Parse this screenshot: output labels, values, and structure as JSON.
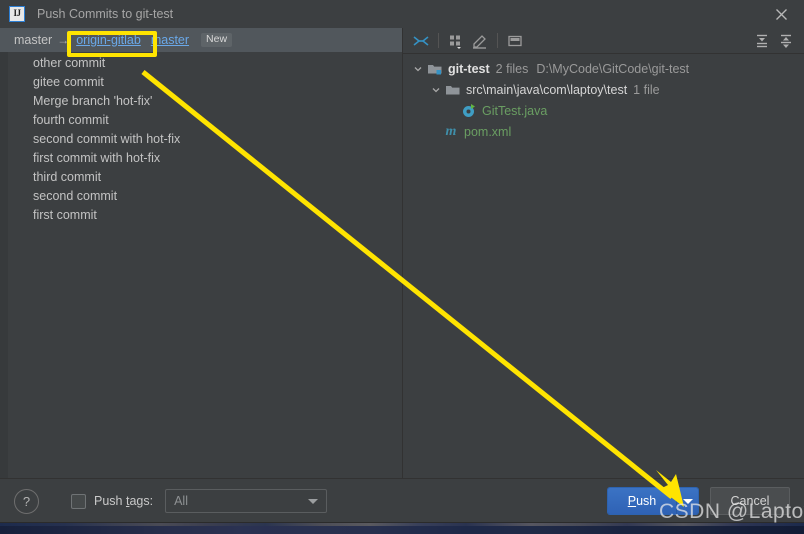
{
  "window": {
    "title": "Push Commits to git-test",
    "logo_text": "IJ",
    "close_icon": "close-icon"
  },
  "branch_bar": {
    "local_branch": "master",
    "arrow": "→",
    "remote_name": "origin-gitlab",
    "remote_branch": "master",
    "badge": "New"
  },
  "commits": [
    "other commit",
    "gitee commit",
    "Merge branch 'hot-fix'",
    "fourth commit",
    "second commit with hot-fix",
    "first commit with hot-fix",
    "third commit",
    "second commit",
    "first commit"
  ],
  "tree_toolbar": {
    "items": [
      {
        "name": "collapse-expand-icon"
      },
      {
        "name": "group-by-icon"
      },
      {
        "name": "edit-source-icon"
      },
      {
        "name": "preview-diff-icon"
      },
      {
        "name": "expand-all-icon"
      },
      {
        "name": "collapse-all-icon"
      }
    ]
  },
  "file_tree": {
    "root": {
      "name": "git-test",
      "count": "2 files",
      "path": "D:\\MyCode\\GitCode\\git-test"
    },
    "folder": {
      "name": "src\\main\\java\\com\\laptoy\\test",
      "count": "1 file"
    },
    "java_file": "GitTest.java",
    "pom_file": "pom.xml",
    "pom_glyph": "m"
  },
  "bottom": {
    "help_label": "?",
    "push_tags_label_pre": "Push ",
    "push_tags_label_mnemonic": "t",
    "push_tags_label_post": "ags:",
    "tags_value": "All",
    "push_label_pre": "",
    "push_label_mnemonic": "P",
    "push_label_post": "ush",
    "cancel_label": "Cancel"
  },
  "annotations": {
    "highlight_color": "#ffe400",
    "arrow_color": "#ffe400",
    "watermark": "CSDN @Laptoy"
  },
  "colors": {
    "dialog_bg": "#3c3f41",
    "branch_row_bg": "#51575c",
    "link": "#6aa8e8",
    "push_button": "#2f62b5",
    "file_green": "#6a9e62"
  }
}
